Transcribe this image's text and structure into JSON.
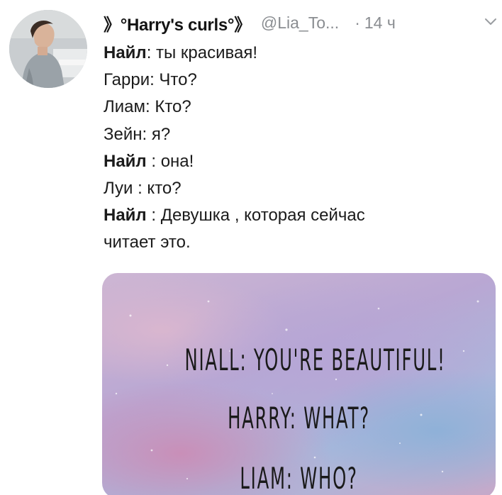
{
  "tweet": {
    "display_name": "》°Harry's curls°》",
    "handle": "@Lia_To...",
    "separator": "·",
    "time": "14 ч",
    "body": [
      {
        "speaker": "Найл",
        "rest": ": ты красивая!"
      },
      {
        "speaker": "",
        "rest": "Гарри: Что?"
      },
      {
        "speaker": "",
        "rest": "Лиам: Кто?"
      },
      {
        "speaker": "",
        "rest": "Зейн: я?"
      },
      {
        "speaker": "Найл",
        "rest": " : она!"
      },
      {
        "speaker": "",
        "rest": "Луи : кто?"
      },
      {
        "speaker": "Найл",
        "rest": " : Девушка , которая сейчас"
      },
      {
        "speaker": "",
        "rest": "читает это."
      }
    ]
  },
  "media": {
    "lines": [
      "NIALL: YOU'RE BEAUTIFUL!",
      "HARRY: WHAT?",
      "LIAM: WHO?"
    ]
  },
  "icons": {
    "caret": "chevron-down-icon",
    "avatar": "avatar"
  },
  "colors": {
    "name": "#141414",
    "meta": "#8a8d91",
    "text": "#1b1b1b"
  }
}
